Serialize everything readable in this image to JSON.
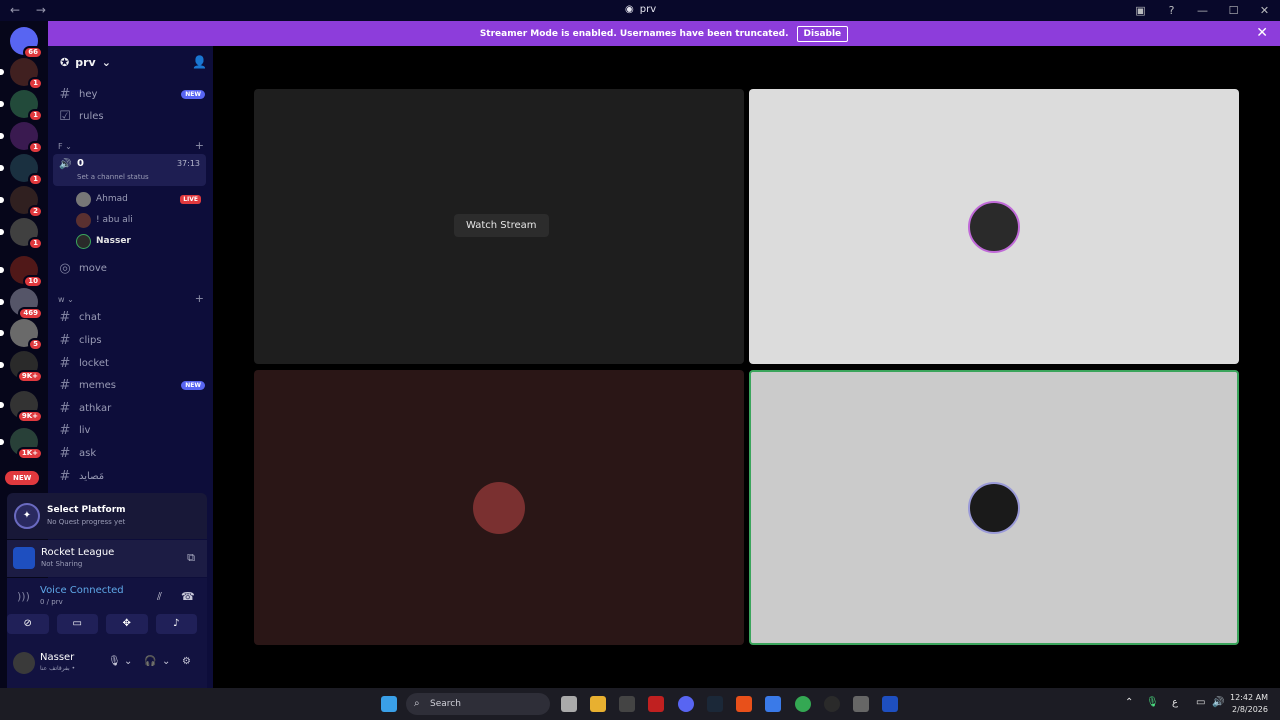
{
  "window": {
    "title": "prv",
    "controls": [
      "—",
      "☐",
      "✕"
    ]
  },
  "banner": {
    "text": "Streamer Mode is enabled. Usernames have been truncated.",
    "button": "Disable"
  },
  "servers": [
    {
      "badge": "66",
      "color": "#5865f2"
    },
    {
      "badge": "1",
      "color": "#d44"
    },
    {
      "badge": "1",
      "color": "#2a7"
    },
    {
      "badge": "1",
      "color": "#a3c"
    },
    {
      "badge": "1",
      "color": "#244"
    },
    {
      "badge": "2",
      "color": "#b33"
    },
    {
      "badge": "1",
      "color": "#555"
    },
    {
      "badge": "10",
      "color": "#922"
    },
    {
      "badge": "469",
      "color": "#667"
    },
    {
      "badge": "5",
      "color": "#777"
    },
    {
      "badge": "9K+",
      "color": "#333"
    },
    {
      "badge": "9K+",
      "color": "#444"
    },
    {
      "badge": "1K+",
      "color": "#365"
    }
  ],
  "new_pill": "NEW",
  "guild": {
    "name": "prv"
  },
  "channels_top": [
    {
      "name": "hey",
      "new": "NEW"
    },
    {
      "name": "rules",
      "new": ""
    }
  ],
  "category_f": "F",
  "voice_channel": {
    "name": "0",
    "time": "37:13",
    "status": "Set a channel status"
  },
  "members": [
    {
      "name": "Ahmad",
      "live": "LIVE"
    },
    {
      "name": "! abu ali",
      "live": ""
    },
    {
      "name": "Nasser",
      "live": ""
    }
  ],
  "move_channel": "move",
  "category_w": "w",
  "channels_w": [
    {
      "name": "chat",
      "new": ""
    },
    {
      "name": "clips",
      "new": ""
    },
    {
      "name": "locket",
      "new": ""
    },
    {
      "name": "memes",
      "new": "NEW"
    },
    {
      "name": "athkar",
      "new": ""
    },
    {
      "name": "liv",
      "new": ""
    },
    {
      "name": "ask",
      "new": ""
    },
    {
      "name": "مَصايد",
      "new": ""
    }
  ],
  "quest": {
    "title": "Select Platform",
    "subtitle": "No Quest progress yet"
  },
  "activity": {
    "title": "Rocket League",
    "subtitle": "Not Sharing"
  },
  "voice_connected": {
    "title": "Voice Connected",
    "subtitle": "0 / prv"
  },
  "user": {
    "name": "Nasser",
    "status": "بفرقاتف عنا •"
  },
  "stage": {
    "watch_label": "Watch Stream"
  },
  "taskbar": {
    "search_label": "Search",
    "time": "12:42 AM",
    "date": "2/8/2026",
    "lang": "ع"
  }
}
